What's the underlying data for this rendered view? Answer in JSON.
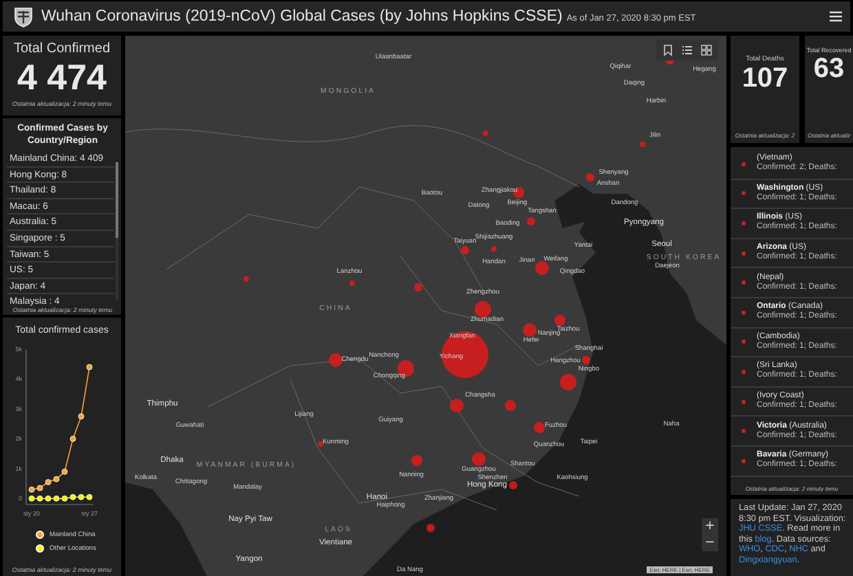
{
  "header": {
    "title": "Wuhan Coronavirus (2019-nCoV) Global Cases (by Johns Hopkins CSSE)",
    "subtitle": "As of Jan 27, 2020 8:30 pm EST"
  },
  "total_confirmed": {
    "label": "Total Confirmed",
    "value": "4 474",
    "footer": "Ostatnia aktualizacja: 2 minuty temu"
  },
  "country_list": {
    "title": "Confirmed Cases by Country/Region",
    "items": [
      {
        "text": "Mainland China: 4 409"
      },
      {
        "text": "Hong Kong: 8"
      },
      {
        "text": "Thailand: 8"
      },
      {
        "text": "Macau: 6"
      },
      {
        "text": "Australia: 5"
      },
      {
        "text": "Singapore : 5"
      },
      {
        "text": "Taiwan: 5"
      },
      {
        "text": "US: 5"
      },
      {
        "text": "Japan: 4"
      },
      {
        "text": "Malaysia : 4"
      }
    ],
    "footer": "Ostatnia aktualizacja: 2 minuty temu"
  },
  "cases_chart": {
    "chart_data": {
      "type": "line",
      "title": "Total confirmed cases",
      "categories": [
        "sty 20",
        null,
        null,
        null,
        null,
        null,
        null,
        "sty 27"
      ],
      "ylim": [
        -200,
        5000
      ],
      "yticks": [
        {
          "value": 0,
          "label": "0"
        },
        {
          "value": 1000,
          "label": "1k"
        },
        {
          "value": 2000,
          "label": "2k"
        },
        {
          "value": 3000,
          "label": "3k"
        },
        {
          "value": 4000,
          "label": "4k"
        },
        {
          "value": 5000,
          "label": "5k"
        }
      ],
      "series": [
        {
          "name": "Mainland China",
          "color": "#f5a431",
          "marker": "circle",
          "values": [
            300,
            350,
            550,
            650,
            900,
            2000,
            2750,
            4400
          ]
        },
        {
          "name": "Other Locations",
          "color": "#f2f20f",
          "marker": "circle",
          "values": [
            0,
            0,
            0,
            0,
            0,
            50,
            50,
            50
          ]
        }
      ]
    },
    "footer": "Ostatnia aktualizacja: 2 minuty temu"
  },
  "map": {
    "labels": [
      {
        "text": "Ulaanbaatar",
        "kind": "city"
      },
      {
        "text": "MONGOLIA",
        "kind": "country"
      },
      {
        "text": "Qiqihar",
        "kind": "city"
      },
      {
        "text": "Hegang",
        "kind": "city"
      },
      {
        "text": "Daqing",
        "kind": "city"
      },
      {
        "text": "Harbin",
        "kind": "city"
      },
      {
        "text": "Jilin",
        "kind": "city"
      },
      {
        "text": "Shenyang",
        "kind": "city"
      },
      {
        "text": "Anshan",
        "kind": "city"
      },
      {
        "text": "Baotou",
        "kind": "city"
      },
      {
        "text": "Zhangjiakou",
        "kind": "city"
      },
      {
        "text": "Datong",
        "kind": "city"
      },
      {
        "text": "Beijing",
        "kind": "city"
      },
      {
        "text": "Tangshan",
        "kind": "city"
      },
      {
        "text": "Dandong",
        "kind": "city"
      },
      {
        "text": "Pyongyang",
        "kind": "capital"
      },
      {
        "text": "Baoding",
        "kind": "city"
      },
      {
        "text": "Taiyuan",
        "kind": "city"
      },
      {
        "text": "Shijiazhuang",
        "kind": "city"
      },
      {
        "text": "Yantai",
        "kind": "city"
      },
      {
        "text": "Seoul",
        "kind": "capital"
      },
      {
        "text": "SOUTH KOREA",
        "kind": "country"
      },
      {
        "text": "Handan",
        "kind": "city"
      },
      {
        "text": "Jinan",
        "kind": "city"
      },
      {
        "text": "Weifang",
        "kind": "city"
      },
      {
        "text": "Qingdao",
        "kind": "city"
      },
      {
        "text": "Daejeon",
        "kind": "city"
      },
      {
        "text": "Lanzhou",
        "kind": "city"
      },
      {
        "text": "Zhengzhou",
        "kind": "city"
      },
      {
        "text": "CHINA",
        "kind": "country"
      },
      {
        "text": "Zhumadian",
        "kind": "city"
      },
      {
        "text": "Xiangfan",
        "kind": "city"
      },
      {
        "text": "Nanjing",
        "kind": "city"
      },
      {
        "text": "Taizhou",
        "kind": "city"
      },
      {
        "text": "Hefei",
        "kind": "city"
      },
      {
        "text": "Shanghai",
        "kind": "city"
      },
      {
        "text": "Chengdu",
        "kind": "city"
      },
      {
        "text": "Nanchong",
        "kind": "city"
      },
      {
        "text": "Yichang",
        "kind": "city"
      },
      {
        "text": "Hangzhou",
        "kind": "city"
      },
      {
        "text": "Chongqing",
        "kind": "city"
      },
      {
        "text": "Ningbo",
        "kind": "city"
      },
      {
        "text": "Changsha",
        "kind": "city"
      },
      {
        "text": "Thimphu",
        "kind": "capital"
      },
      {
        "text": "Lijiang",
        "kind": "city"
      },
      {
        "text": "Guwahati",
        "kind": "city"
      },
      {
        "text": "Guiyang",
        "kind": "city"
      },
      {
        "text": "Fuzhou",
        "kind": "city"
      },
      {
        "text": "Naha",
        "kind": "city"
      },
      {
        "text": "Kunming",
        "kind": "city"
      },
      {
        "text": "Quanzhou",
        "kind": "city"
      },
      {
        "text": "Taipei",
        "kind": "city"
      },
      {
        "text": "Dhaka",
        "kind": "capital"
      },
      {
        "text": "MYANMAR (BURMA)",
        "kind": "country"
      },
      {
        "text": "Nanning",
        "kind": "city"
      },
      {
        "text": "Guangzhou",
        "kind": "city"
      },
      {
        "text": "Shantou",
        "kind": "city"
      },
      {
        "text": "Shenzhen",
        "kind": "city"
      },
      {
        "text": "Hong Kong",
        "kind": "capital"
      },
      {
        "text": "Kolkata",
        "kind": "city"
      },
      {
        "text": "Chittagong",
        "kind": "city"
      },
      {
        "text": "Mandalay",
        "kind": "city"
      },
      {
        "text": "Kaohsiung",
        "kind": "city"
      },
      {
        "text": "Hanoi",
        "kind": "capital"
      },
      {
        "text": "Haiphong",
        "kind": "city"
      },
      {
        "text": "Zhanjiang",
        "kind": "city"
      },
      {
        "text": "Nay Pyi Taw",
        "kind": "capital"
      },
      {
        "text": "LAOS",
        "kind": "country"
      },
      {
        "text": "Vientiane",
        "kind": "capital"
      },
      {
        "text": "Yangon",
        "kind": "capital"
      },
      {
        "text": "Da Nang",
        "kind": "city"
      }
    ],
    "attribution": "Esri, HERE | Esri, HERE",
    "zoom_in": "+",
    "zoom_out": "−"
  },
  "total_deaths": {
    "label": "Total Deaths",
    "value": "107",
    "footer": "Ostatnia aktualizacja: 2"
  },
  "total_recovered": {
    "label": "Total Recovered",
    "value": "63",
    "footer": "Ostatnia aktualiz"
  },
  "region_list": {
    "items": [
      {
        "name": "(Vietnam)",
        "detail": "Confirmed: 2; Deaths:"
      },
      {
        "name": "**Washington** (US)",
        "detail": "Confirmed: 1; Deaths:"
      },
      {
        "name": "**Illinois** (US)",
        "detail": "Confirmed: 1; Deaths:"
      },
      {
        "name": "**Arizona** (US)",
        "detail": "Confirmed: 1; Deaths:"
      },
      {
        "name": "(Nepal)",
        "detail": "Confirmed: 1; Deaths:"
      },
      {
        "name": "**Ontario** (Canada)",
        "detail": "Confirmed: 1; Deaths:"
      },
      {
        "name": "(Cambodia)",
        "detail": "Confirmed: 1; Deaths:"
      },
      {
        "name": "(Sri Lanka)",
        "detail": "Confirmed: 1; Deaths:"
      },
      {
        "name": "(Ivory Coast)",
        "detail": "Confirmed: 1; Deaths:"
      },
      {
        "name": "**Victoria** (Australia)",
        "detail": "Confirmed: 1; Deaths:"
      },
      {
        "name": "**Bavaria** (Germany)",
        "detail": "Confirmed: 1; Deaths:"
      }
    ],
    "footer": "Ostatnia aktualizacja: 2 minuty temu"
  },
  "info": {
    "segments": [
      {
        "text": "Last Update: Jan 27, 2020 8:30 pm EST. Visualization: ",
        "kind": "text"
      },
      {
        "text": "JHU CSSE",
        "kind": "link"
      },
      {
        "text": ". Read more in this ",
        "kind": "text"
      },
      {
        "text": "blog",
        "kind": "link"
      },
      {
        "text": ". Data sources: ",
        "kind": "text"
      },
      {
        "text": "WHO",
        "kind": "link"
      },
      {
        "text": ", ",
        "kind": "text"
      },
      {
        "text": "CDC",
        "kind": "link"
      },
      {
        "text": ", ",
        "kind": "text"
      },
      {
        "text": "NHC",
        "kind": "link"
      },
      {
        "text": " and ",
        "kind": "text"
      },
      {
        "text": "Dingxiangyuan",
        "kind": "link"
      },
      {
        "text": ".",
        "kind": "text"
      }
    ]
  }
}
